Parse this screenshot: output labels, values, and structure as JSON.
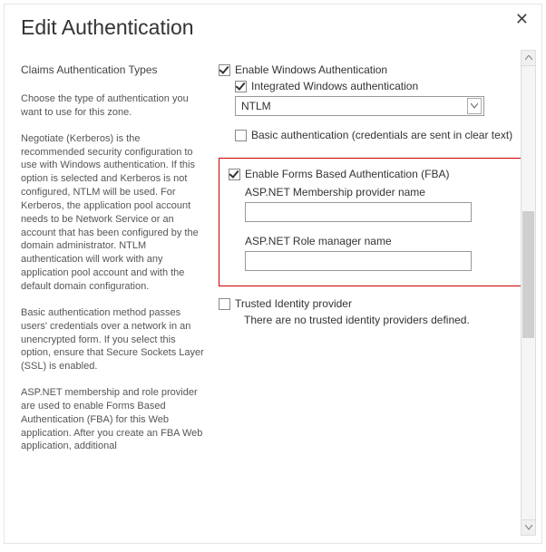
{
  "dialog": {
    "title": "Edit Authentication",
    "close": "✕"
  },
  "left": {
    "heading": "Claims Authentication Types",
    "p1": "Choose the type of authentication you want to use for this zone.",
    "p2": "Negotiate (Kerberos) is the recommended security configuration to use with Windows authentication. If this option is selected and Kerberos is not configured, NTLM will be used. For Kerberos, the application pool account needs to be Network Service or an account that has been configured by the domain administrator. NTLM authentication will work with any application pool account and with the default domain configuration.",
    "p3": "Basic authentication method passes users' credentials over a network in an unencrypted form. If you select this option, ensure that Secure Sockets Layer (SSL) is enabled.",
    "p4": "ASP.NET membership and role provider are used to enable Forms Based Authentication (FBA) for this Web application. After you create an FBA Web application, additional"
  },
  "right": {
    "enable_windows": "Enable Windows Authentication",
    "integrated_windows": "Integrated Windows authentication",
    "ntlm_selected": "NTLM",
    "basic_auth": "Basic authentication (credentials are sent in clear text)",
    "enable_fba": "Enable Forms Based Authentication (FBA)",
    "membership_label": "ASP.NET Membership provider name",
    "role_label": "ASP.NET Role manager name",
    "trusted_identity": "Trusted Identity provider",
    "trusted_msg": "There are no trusted identity providers defined."
  }
}
